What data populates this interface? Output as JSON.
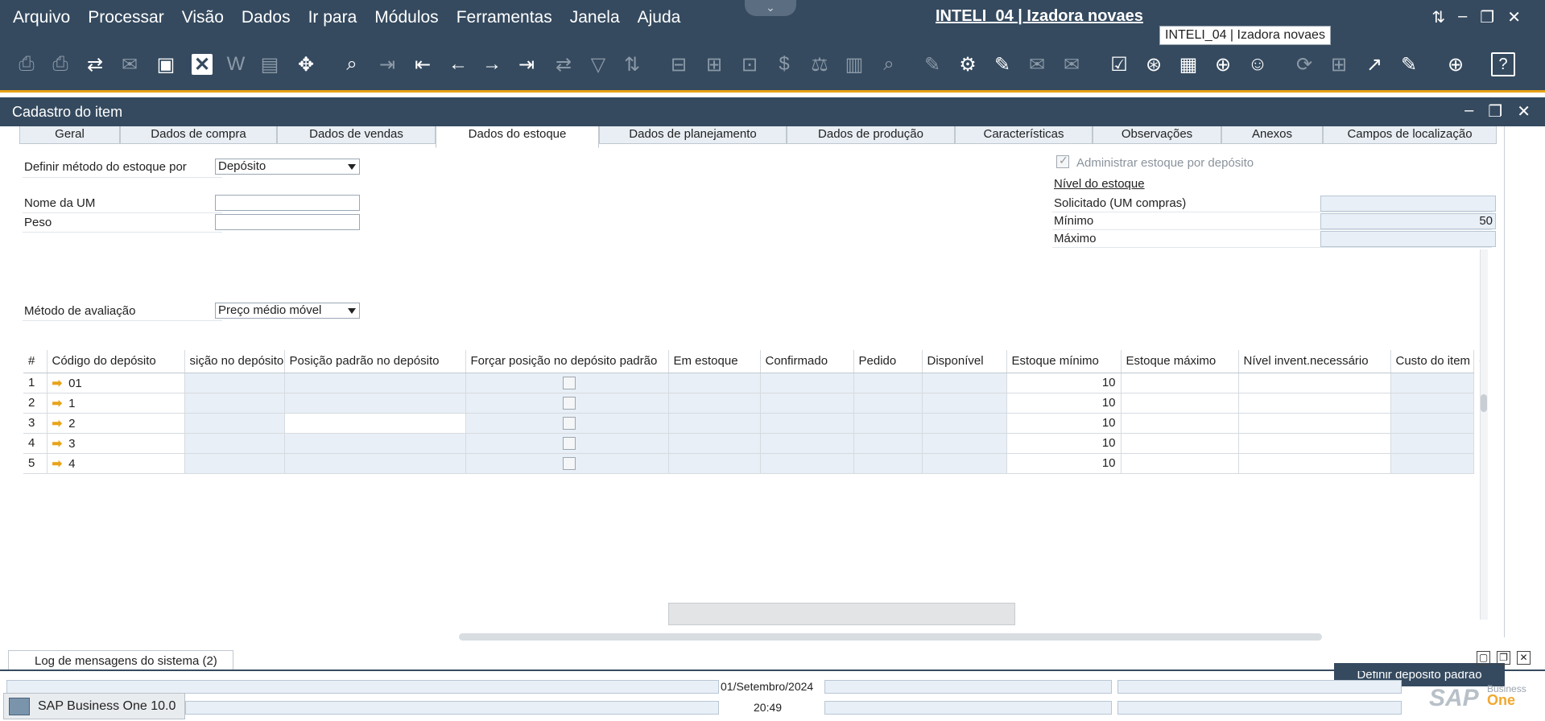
{
  "menu": {
    "items": [
      "Arquivo",
      "Processar",
      "Visão",
      "Dados",
      "Ir para",
      "Módulos",
      "Ferramentas",
      "Janela",
      "Ajuda"
    ],
    "company_title": "INTELI_04 | Izadora novaes",
    "tooltip": "INTELI_04 | Izadora novaes"
  },
  "window": {
    "title": "Cadastro do item"
  },
  "tabs": [
    {
      "label": "Geral"
    },
    {
      "label": "Dados de compra"
    },
    {
      "label": "Dados de vendas"
    },
    {
      "label": "Dados do estoque"
    },
    {
      "label": "Dados de planejamento"
    },
    {
      "label": "Dados de produção"
    },
    {
      "label": "Características"
    },
    {
      "label": "Observações"
    },
    {
      "label": "Anexos"
    },
    {
      "label": "Campos de localização"
    }
  ],
  "form": {
    "definir_metodo_label": "Definir método do estoque por",
    "definir_metodo_value": "Depósito",
    "nome_um_label": "Nome da UM",
    "nome_um_value": "",
    "peso_label": "Peso",
    "peso_value": "",
    "metodo_avaliacao_label": "Método de avaliação",
    "metodo_avaliacao_value": "Preço médio móvel",
    "administrar_label": "Administrar estoque por depósito",
    "nivel_title": "Nível do estoque",
    "solicitado_label": "Solicitado (UM compras)",
    "solicitado_value": "",
    "minimo_label": "Mínimo",
    "minimo_value": "50",
    "maximo_label": "Máximo",
    "maximo_value": ""
  },
  "grid": {
    "columns": [
      "#",
      "Código do depósito",
      "sição no depósito",
      "Posição padrão no depósito",
      "Forçar posição no depósito padrão",
      "Em estoque",
      "Confirmado",
      "Pedido",
      "Disponível",
      "Estoque mínimo",
      "Estoque máximo",
      "Nível invent.necessário",
      "Custo do item"
    ],
    "rows": [
      {
        "n": "1",
        "code": "01",
        "min": "10"
      },
      {
        "n": "2",
        "code": "1",
        "min": "10"
      },
      {
        "n": "3",
        "code": "2",
        "min": "10"
      },
      {
        "n": "4",
        "code": "3",
        "min": "10"
      },
      {
        "n": "5",
        "code": "4",
        "min": "10"
      }
    ]
  },
  "buttons": {
    "definir_deposito": "Definir depósito padrão"
  },
  "footer": {
    "log_tab": "Log de mensagens do sistema (2)",
    "date": "01/Setembro/2024",
    "time": "20:49",
    "taskbar": "SAP Business One 10.0",
    "brand_sap": "SAP",
    "brand_business": "Business",
    "brand_one": "One"
  },
  "colors": {
    "header_bg": "#354a5f",
    "accent": "#e8a317",
    "readonly_field": "#e8eff6"
  }
}
